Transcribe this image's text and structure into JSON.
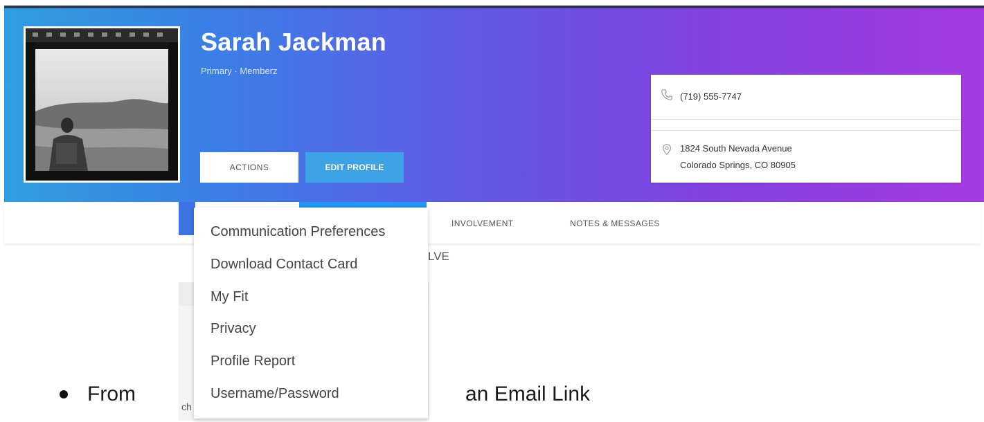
{
  "profile": {
    "name": "Sarah Jackman",
    "role": "Primary · Memberz",
    "photo_alt": "profile-photo"
  },
  "buttons": {
    "actions_label": "ACTIONS",
    "edit_profile_label": "EDIT PROFILE"
  },
  "contact": {
    "phone": "(719) 555-7747",
    "address_line1": "1824 South Nevada Avenue",
    "address_line2": "Colorado Springs, CO 80905"
  },
  "tabs": [
    {
      "label": "INVOLVEMENT"
    },
    {
      "label": "NOTES & MESSAGES"
    }
  ],
  "partially_hidden": {
    "text_right": "LVE",
    "text_bottom": "ch"
  },
  "actions_menu": {
    "items": [
      {
        "label": "Communication Preferences"
      },
      {
        "label": "Download Contact Card"
      },
      {
        "label": "My Fit"
      },
      {
        "label": "Privacy"
      },
      {
        "label": "Profile Report"
      },
      {
        "label": "Username/Password"
      }
    ]
  },
  "document": {
    "bullet_from": "From",
    "bullet_email": "an Email Link"
  },
  "colors": {
    "gradient_start": "#2f9fe0",
    "gradient_end": "#a53be0",
    "edit_button": "#3ea3e6"
  }
}
